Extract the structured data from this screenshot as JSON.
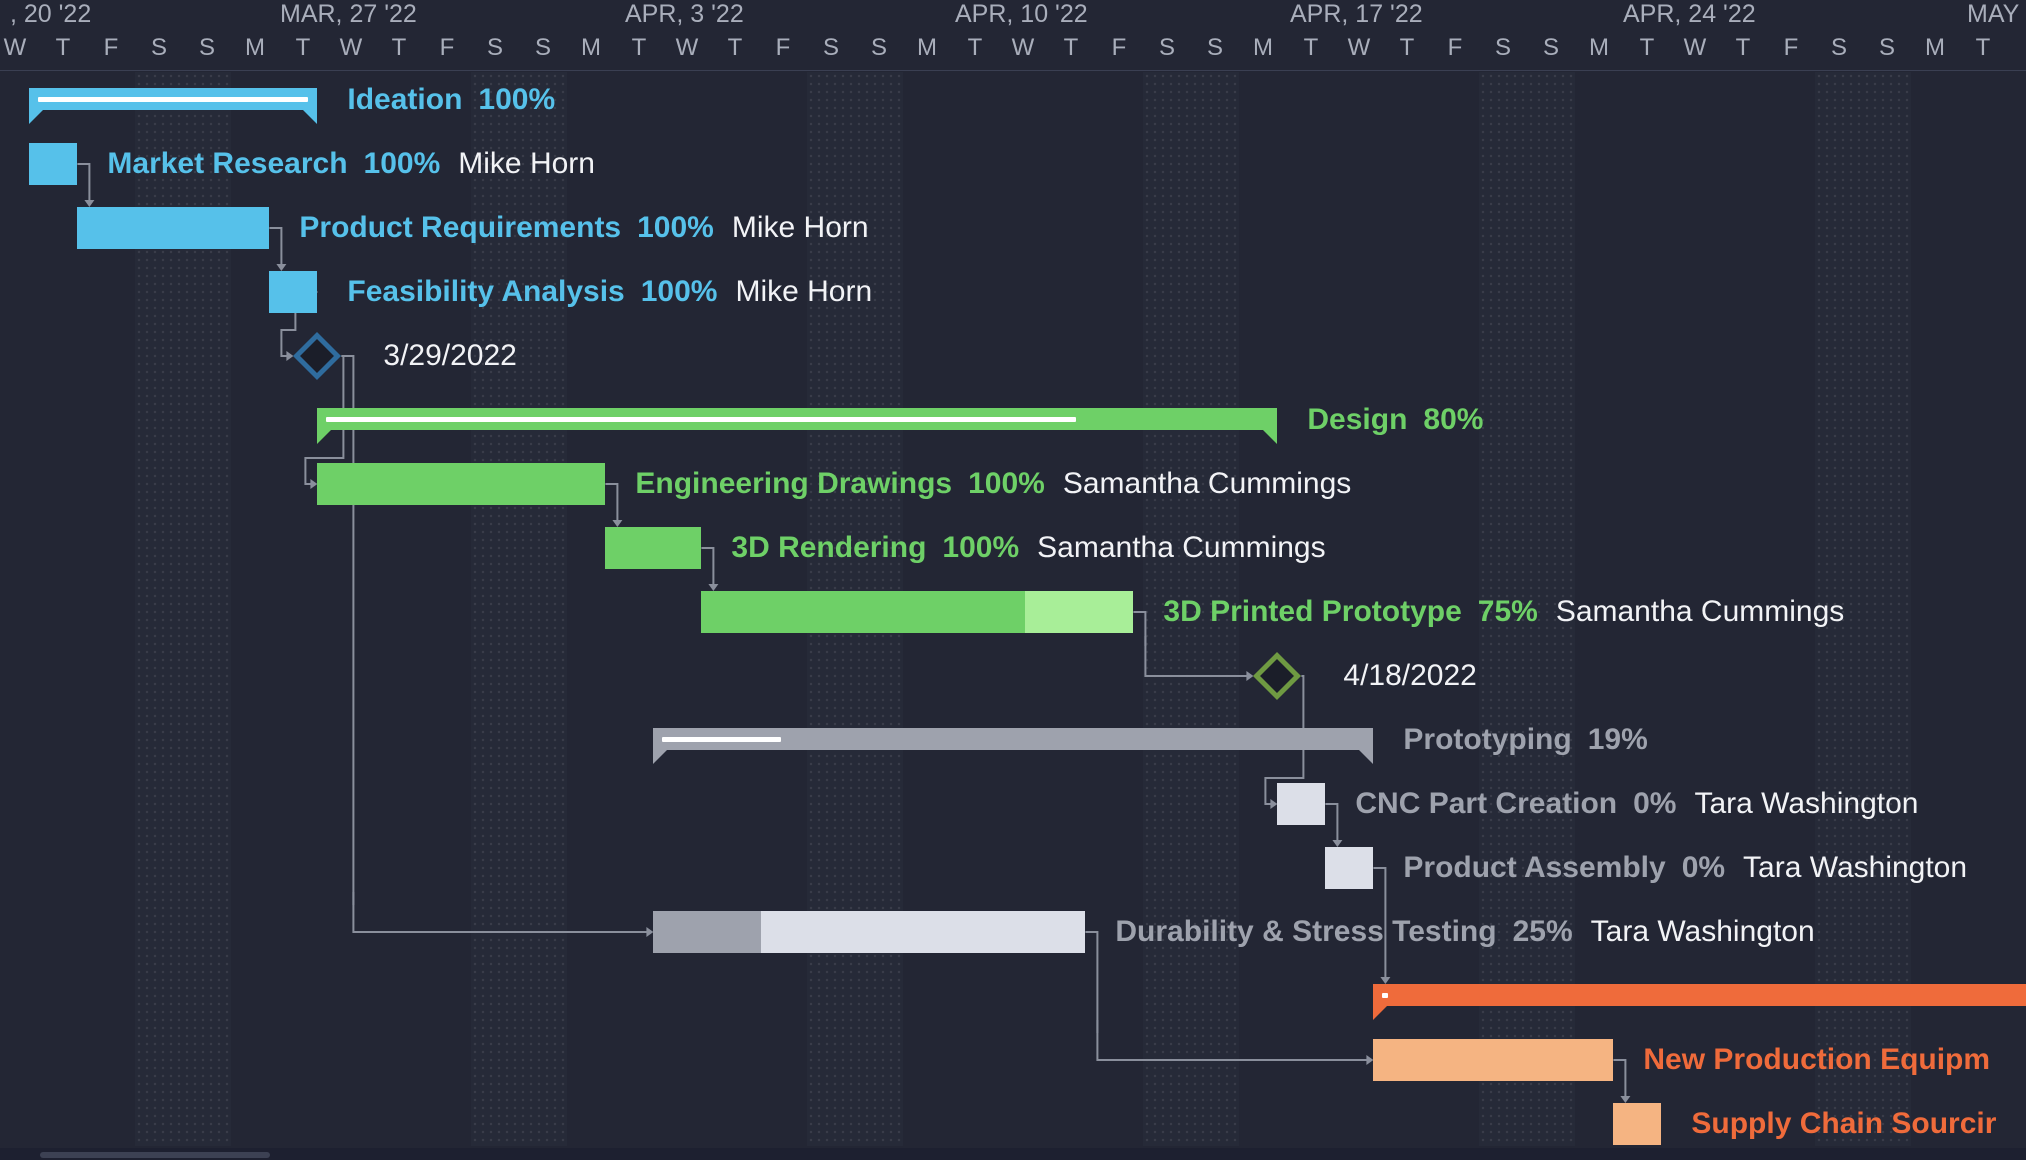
{
  "timeline": {
    "week_labels": [
      ", 20 '22",
      "MAR, 27 '22",
      "APR, 3 '22",
      "APR, 10 '22",
      "APR, 17 '22",
      "APR, 24 '22",
      "MAY"
    ],
    "day_letters": [
      "W",
      "T",
      "F",
      "S",
      "S",
      "M",
      "T",
      "W",
      "T",
      "F",
      "S",
      "S",
      "M",
      "T",
      "W",
      "T",
      "F",
      "S",
      "S",
      "M",
      "T",
      "W",
      "T",
      "F",
      "S",
      "S",
      "M",
      "T",
      "W",
      "T",
      "F",
      "S",
      "S",
      "M",
      "T",
      "W",
      "T",
      "F",
      "S",
      "S",
      "M",
      "T"
    ]
  },
  "colors": {
    "ideation": "#56c1ea",
    "design": "#6ed067",
    "design_light": "#a8ee98",
    "prototyping": "#9ea2ad",
    "proto_light": "#dcdfe8",
    "production": "#ef6b3b",
    "production_light": "#f5b482",
    "link": "#8a8f9c"
  },
  "tasks": [
    {
      "name": "Ideation",
      "percent": "100%",
      "resource": "",
      "group": "ideation",
      "summary": true,
      "start_day": 0.8,
      "duration_days": 6,
      "progress": 1.0
    },
    {
      "name": "Market Research",
      "percent": "100%",
      "resource": "Mike Horn",
      "group": "ideation",
      "start_day": 0.8,
      "duration_days": 1,
      "progress": 1.0
    },
    {
      "name": "Product Requirements",
      "percent": "100%",
      "resource": "Mike Horn",
      "group": "ideation",
      "start_day": 1.8,
      "duration_days": 4,
      "progress": 1.0
    },
    {
      "name": "Feasibility Analysis",
      "percent": "100%",
      "resource": "Mike Horn",
      "group": "ideation",
      "start_day": 5.8,
      "duration_days": 1,
      "progress": 1.0
    },
    {
      "name": "",
      "milestone": true,
      "date": "3/29/2022",
      "group": "ideation",
      "start_day": 6.8
    },
    {
      "name": "Design",
      "percent": "80%",
      "resource": "",
      "group": "design",
      "summary": true,
      "start_day": 6.8,
      "duration_days": 20,
      "progress": 0.8
    },
    {
      "name": "Engineering Drawings",
      "percent": "100%",
      "resource": "Samantha Cummings",
      "group": "design",
      "start_day": 6.8,
      "duration_days": 6,
      "progress": 1.0
    },
    {
      "name": "3D Rendering",
      "percent": "100%",
      "resource": "Samantha Cummings",
      "group": "design",
      "start_day": 12.8,
      "duration_days": 2,
      "progress": 1.0
    },
    {
      "name": "3D Printed Prototype",
      "percent": "75%",
      "resource": "Samantha Cummings",
      "group": "design",
      "start_day": 14.8,
      "duration_days": 9,
      "progress": 0.75
    },
    {
      "name": "",
      "milestone": true,
      "date": "4/18/2022",
      "group": "design",
      "start_day": 26.8
    },
    {
      "name": "Prototyping",
      "percent": "19%",
      "resource": "",
      "group": "prototyping",
      "summary": true,
      "start_day": 13.8,
      "duration_days": 15,
      "progress": 0.19
    },
    {
      "name": "CNC Part Creation",
      "percent": "0%",
      "resource": "Tara Washington",
      "group": "prototyping",
      "start_day": 26.8,
      "duration_days": 1,
      "progress": 0
    },
    {
      "name": "Product Assembly",
      "percent": "0%",
      "resource": "Tara Washington",
      "group": "prototyping",
      "start_day": 27.8,
      "duration_days": 1,
      "progress": 0
    },
    {
      "name": "Durability & Stress Testing",
      "percent": "25%",
      "resource": "Tara Washington",
      "group": "prototyping",
      "start_day": 13.8,
      "duration_days": 9,
      "progress": 0.25
    },
    {
      "name": "",
      "percent": "",
      "resource": "",
      "group": "production",
      "summary": true,
      "start_day": 28.8,
      "duration_days": 14,
      "progress": 0
    },
    {
      "name": "New Production Equipm",
      "percent": "",
      "resource": "",
      "group": "production",
      "start_day": 28.8,
      "duration_days": 5,
      "progress": 1.0
    },
    {
      "name": "Supply Chain Sourcir",
      "percent": "",
      "resource": "",
      "group": "production",
      "start_day": 33.8,
      "duration_days": 1,
      "progress": 1.0
    }
  ],
  "links": [
    [
      1,
      2
    ],
    [
      2,
      3
    ],
    [
      3,
      4
    ],
    [
      4,
      6
    ],
    [
      6,
      7
    ],
    [
      7,
      8
    ],
    [
      8,
      9
    ],
    [
      9,
      11
    ],
    [
      11,
      12
    ],
    [
      12,
      14
    ],
    [
      4,
      13
    ],
    [
      13,
      15
    ],
    [
      15,
      16
    ]
  ]
}
